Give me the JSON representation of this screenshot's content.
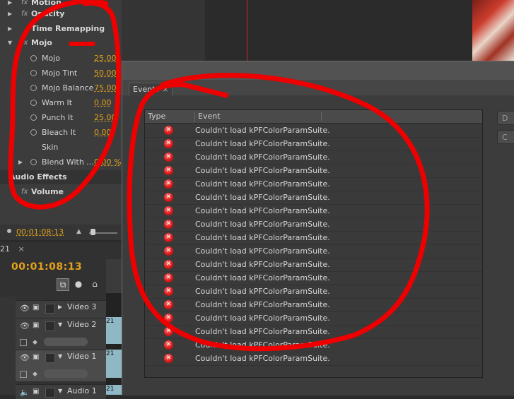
{
  "effect_controls": {
    "top_rows": [
      {
        "name": "Motion",
        "expanded": false,
        "fx": true
      },
      {
        "name": "Opacity",
        "expanded": false,
        "fx": true
      },
      {
        "name": "Time Remapping",
        "expanded": false,
        "fx": false
      },
      {
        "name": "Mojo",
        "expanded": true,
        "fx": true
      }
    ],
    "mojo_params": [
      {
        "name": "Mojo",
        "value": "25.00"
      },
      {
        "name": "Mojo Tint",
        "value": "50.00"
      },
      {
        "name": "Mojo Balance",
        "value": "75.00"
      },
      {
        "name": "Warm It",
        "value": "0.00"
      },
      {
        "name": "Punch It",
        "value": "25.00"
      },
      {
        "name": "Bleach It",
        "value": "0.00"
      },
      {
        "name": "Skin",
        "value": ""
      },
      {
        "name": "Blend With ...",
        "value": "0.00 %"
      }
    ],
    "audio_section": "Audio Effects",
    "volume_row": "Volume",
    "current_time": "00:01:08:13"
  },
  "timeline": {
    "tab_label": "21",
    "tab_close": "×",
    "current_time": "00:01:08:13",
    "tracks": [
      {
        "name": "Video 3",
        "expanded": false
      },
      {
        "name": "Video 2",
        "expanded": true
      },
      {
        "name": "Video 1",
        "expanded": true
      },
      {
        "name": "Audio 1",
        "expanded": true
      }
    ],
    "clip_labels": [
      "21",
      "21",
      "21"
    ]
  },
  "events_dialog": {
    "tab_label": "Events",
    "tab_close": "×",
    "columns": [
      "Type",
      "Event"
    ],
    "rows": [
      {
        "type": "error",
        "event": "Couldn't load kPFColorParamSuite."
      },
      {
        "type": "error",
        "event": "Couldn't load kPFColorParamSuite."
      },
      {
        "type": "error",
        "event": "Couldn't load kPFColorParamSuite."
      },
      {
        "type": "error",
        "event": "Couldn't load kPFColorParamSuite."
      },
      {
        "type": "error",
        "event": "Couldn't load kPFColorParamSuite."
      },
      {
        "type": "error",
        "event": "Couldn't load kPFColorParamSuite."
      },
      {
        "type": "error",
        "event": "Couldn't load kPFColorParamSuite."
      },
      {
        "type": "error",
        "event": "Couldn't load kPFColorParamSuite."
      },
      {
        "type": "error",
        "event": "Couldn't load kPFColorParamSuite."
      },
      {
        "type": "error",
        "event": "Couldn't load kPFColorParamSuite."
      },
      {
        "type": "error",
        "event": "Couldn't load kPFColorParamSuite."
      },
      {
        "type": "error",
        "event": "Couldn't load kPFColorParamSuite."
      },
      {
        "type": "error",
        "event": "Couldn't load kPFColorParamSuite."
      },
      {
        "type": "error",
        "event": "Couldn't load kPFColorParamSuite."
      },
      {
        "type": "error",
        "event": "Couldn't load kPFColorParamSuite."
      },
      {
        "type": "error",
        "event": "Couldn't load kPFColorParamSuite."
      },
      {
        "type": "error",
        "event": "Couldn't load kPFColorParamSuite."
      },
      {
        "type": "error",
        "event": "Couldn't load kPFColorParamSuite."
      }
    ],
    "side_buttons": [
      "D",
      "C"
    ]
  },
  "colors": {
    "timecode": "#e3a21a",
    "error": "#e01818",
    "annotation": "#ee0000",
    "playhead": "#c8282a"
  },
  "icons": {
    "reset": "reset-icon",
    "error": "error-icon",
    "eye": "eye-icon",
    "camera": "film-icon",
    "tools": [
      "snap-icon",
      "marker-icon",
      "home-icon"
    ]
  }
}
